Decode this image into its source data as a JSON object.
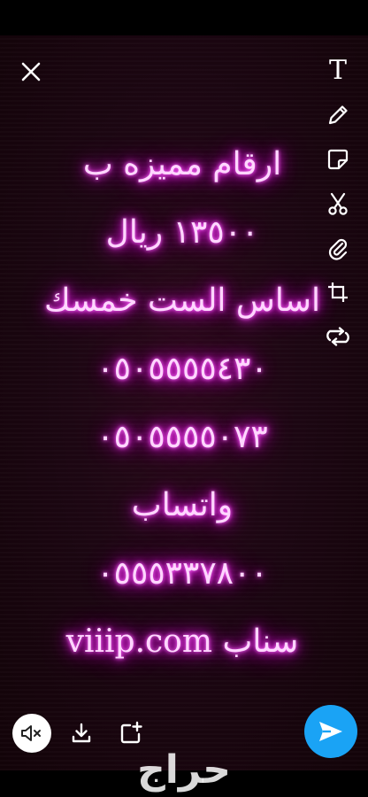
{
  "icons": {
    "close": "close-icon",
    "text": "text-icon",
    "pencil": "pencil-icon",
    "sticker": "sticker-icon",
    "scissors": "scissors-icon",
    "attachment": "paperclip-icon",
    "crop": "crop-icon",
    "loop": "loop-icon",
    "mute": "mute-icon",
    "download": "download-icon",
    "add_story": "add-story-icon",
    "send": "send-icon"
  },
  "toolbar": {
    "text_glyph": "T"
  },
  "message": {
    "lines": [
      "ارقام مميزه ب",
      "١٣٥٠٠ ريال",
      "اساس الست خمسك",
      "٠٥٠٥٥٥٥٤٣٠",
      "٠٥٠٥٥٥٥٠٧٣",
      "واتساب",
      "٠٥٥٥٣٣٧٨٠٠",
      "سناب viiip.com"
    ]
  },
  "watermark": {
    "text": "حراج"
  },
  "colors": {
    "glow": "#ff2bff",
    "send_button": "#1aa3f5",
    "background": "#1c0612"
  }
}
